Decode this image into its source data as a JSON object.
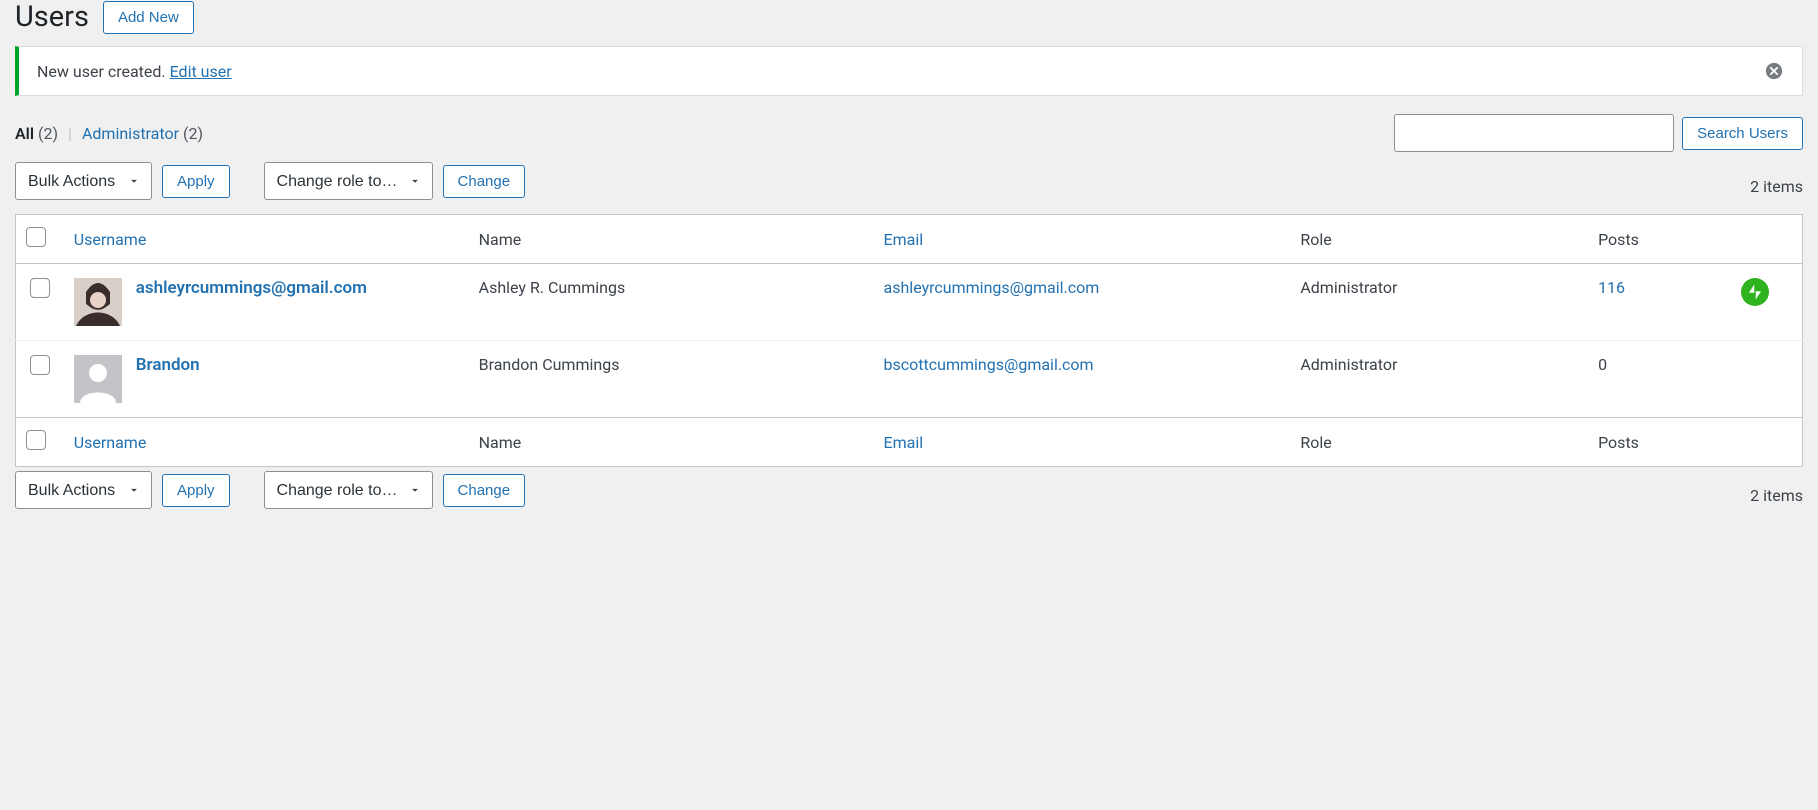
{
  "header": {
    "title": "Users",
    "add_new_label": "Add New"
  },
  "notice": {
    "message": "New user created. ",
    "link_label": "Edit user"
  },
  "filters": {
    "all_label": "All",
    "all_count": "(2)",
    "admin_label": "Administrator",
    "admin_count": "(2)"
  },
  "search": {
    "button_label": "Search Users"
  },
  "bulk": {
    "bulk_actions_label": "Bulk Actions",
    "apply_label": "Apply",
    "change_role_label": "Change role to…",
    "change_label": "Change"
  },
  "pagination": {
    "items_label": "2 items"
  },
  "columns": {
    "username": "Username",
    "name": "Name",
    "email": "Email",
    "role": "Role",
    "posts": "Posts"
  },
  "rows": [
    {
      "username": "ashleyrcummings@gmail.com",
      "name": "Ashley R. Cummings",
      "email": "ashleyrcummings@gmail.com",
      "role": "Administrator",
      "posts": "116",
      "has_photo": true,
      "has_badge": true
    },
    {
      "username": "Brandon",
      "name": "Brandon Cummings",
      "email": "bscottcummings@gmail.com",
      "role": "Administrator",
      "posts": "0",
      "has_photo": false,
      "has_badge": false
    }
  ]
}
